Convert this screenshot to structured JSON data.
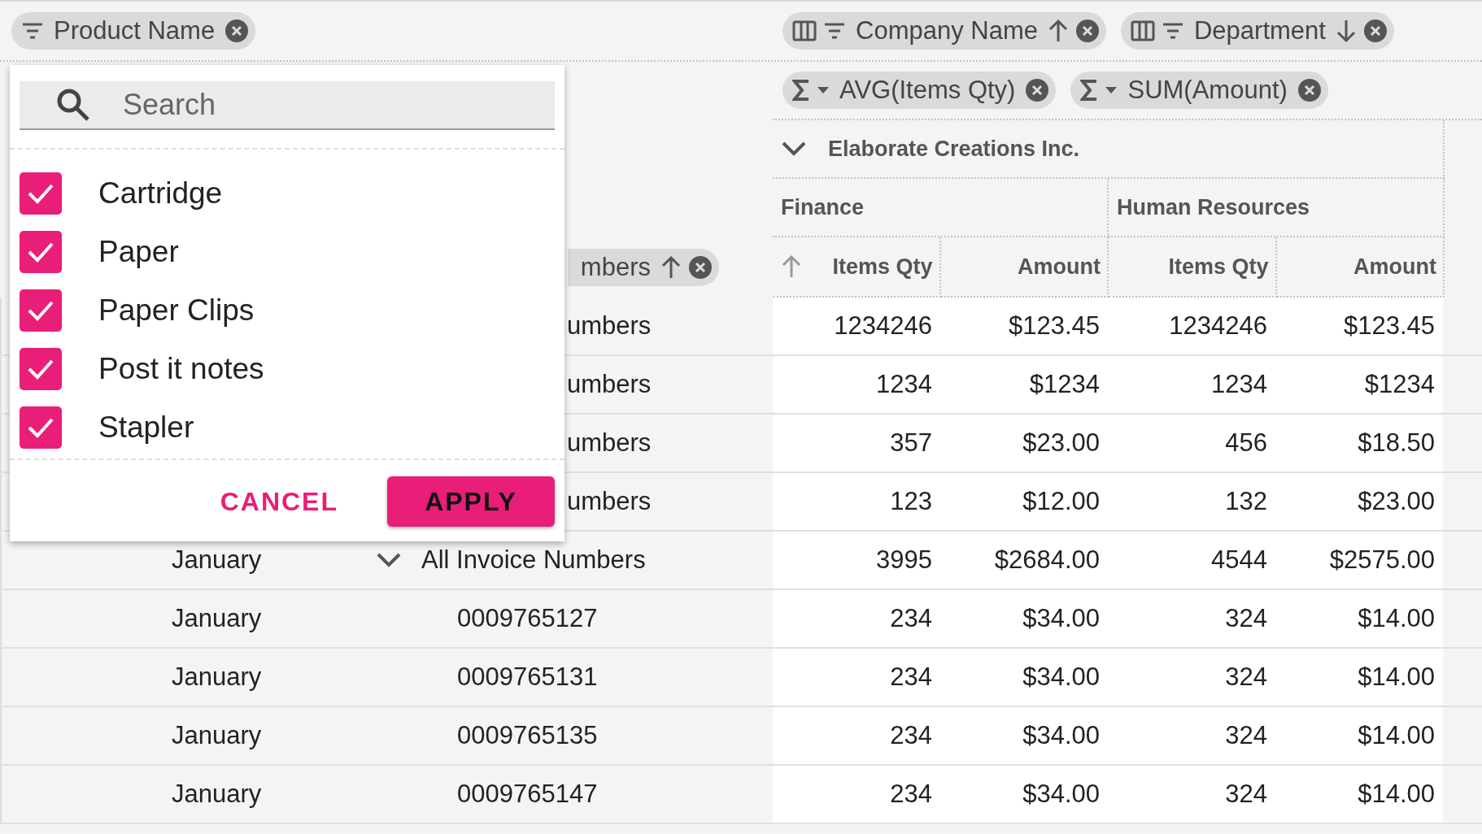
{
  "row_area": {
    "chips": [
      {
        "label": "Product Name"
      }
    ]
  },
  "column_area": {
    "chips": [
      {
        "label": "Company Name",
        "ascending": true
      },
      {
        "label": "Department",
        "ascending": false
      }
    ]
  },
  "values_area": {
    "chips": [
      {
        "label": "AVG(Items Qty)"
      },
      {
        "label": "SUM(Amount)"
      }
    ]
  },
  "row_header_chip": {
    "label": "mbers",
    "ascending": true
  },
  "company": {
    "label": "Elaborate Creations Inc.",
    "expanded": true
  },
  "departments": [
    "Finance",
    "Human Resources"
  ],
  "measures": [
    {
      "label": "Items Qty",
      "sorted": true
    },
    {
      "label": "Amount",
      "sorted": false
    },
    {
      "label": "Items Qty",
      "sorted": false
    },
    {
      "label": "Amount",
      "sorted": false
    }
  ],
  "rows": [
    {
      "kind": "covered",
      "invoice": "umbers",
      "values": [
        "1234246",
        "$123.45",
        "1234246",
        "$123.45"
      ]
    },
    {
      "kind": "covered",
      "invoice": "umbers",
      "values": [
        "1234",
        "$1234",
        "1234",
        "$1234"
      ]
    },
    {
      "kind": "covered",
      "invoice": "umbers",
      "values": [
        "357",
        "$23.00",
        "456",
        "$18.50"
      ]
    },
    {
      "kind": "covered",
      "invoice": "umbers",
      "values": [
        "123",
        "$12.00",
        "132",
        "$23.00"
      ]
    },
    {
      "kind": "group",
      "month": "January",
      "invoice": "All Invoice Numbers",
      "expanded": true,
      "values": [
        "3995",
        "$2684.00",
        "4544",
        "$2575.00"
      ]
    },
    {
      "kind": "item",
      "month": "January",
      "invoice": "0009765127",
      "values": [
        "234",
        "$34.00",
        "324",
        "$14.00"
      ]
    },
    {
      "kind": "item",
      "month": "January",
      "invoice": "0009765131",
      "values": [
        "234",
        "$34.00",
        "324",
        "$14.00"
      ]
    },
    {
      "kind": "item",
      "month": "January",
      "invoice": "0009765135",
      "values": [
        "234",
        "$34.00",
        "324",
        "$14.00"
      ]
    },
    {
      "kind": "item",
      "month": "January",
      "invoice": "0009765147",
      "values": [
        "234",
        "$34.00",
        "324",
        "$14.00"
      ]
    }
  ],
  "filter_popup": {
    "search": {
      "placeholder": "Search"
    },
    "options": [
      {
        "label": "Cartridge",
        "checked": true
      },
      {
        "label": "Paper",
        "checked": true
      },
      {
        "label": "Paper Clips",
        "checked": true
      },
      {
        "label": "Post it notes",
        "checked": true
      },
      {
        "label": "Stapler",
        "checked": true
      }
    ],
    "cancel": "CANCEL",
    "apply": "APPLY"
  }
}
